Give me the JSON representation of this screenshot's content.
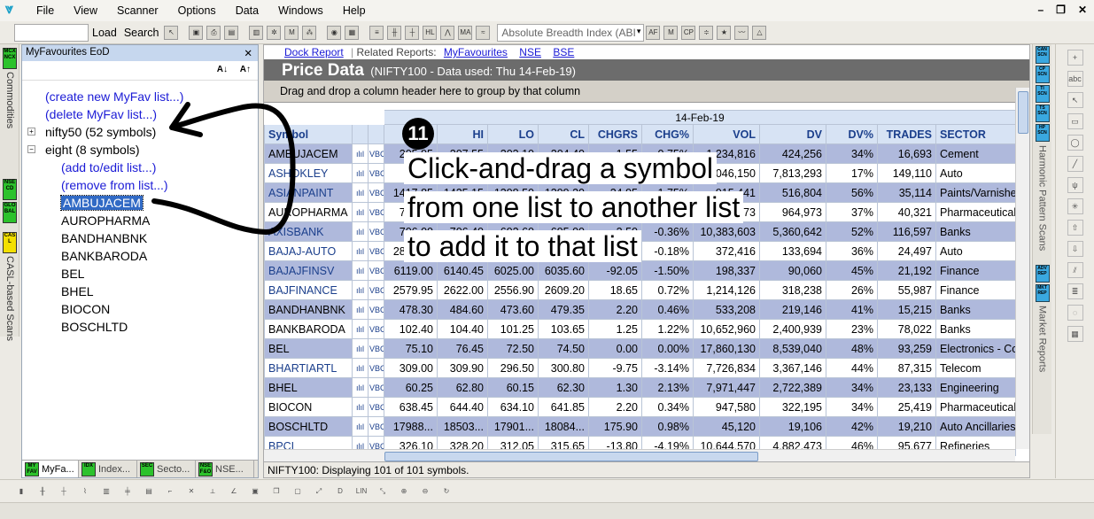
{
  "menu": [
    "File",
    "View",
    "Scanner",
    "Options",
    "Data",
    "Windows",
    "Help"
  ],
  "toolbar": {
    "load_label": "Load",
    "search_label": "Search",
    "breadth_select": "Absolute Breadth Index (ABI"
  },
  "left_tabs": [
    {
      "icon": "MCX NCX",
      "label": "Commodities"
    },
    {
      "icon": "NSE CD",
      "label": ""
    },
    {
      "icon": "GLO BAL",
      "label": ""
    },
    {
      "icon": "CAS L",
      "label": "CASL-based Scans"
    }
  ],
  "myfav": {
    "title": "MyFavourites EoD",
    "sort_az": "A↓",
    "sort_za": "A↑",
    "tree": [
      {
        "text": "(create new MyFav list...)",
        "type": "link",
        "indent": 0
      },
      {
        "text": "(delete MyFav list...)",
        "type": "link",
        "indent": 0
      },
      {
        "text": "nifty50 (52 symbols)",
        "type": "folder",
        "indent": 0,
        "exp": "+"
      },
      {
        "text": "eight (8 symbols)",
        "type": "folder",
        "indent": 0,
        "exp": "−"
      },
      {
        "text": "(add to/edit list...)",
        "type": "link",
        "indent": 1
      },
      {
        "text": "(remove from list...)",
        "type": "link",
        "indent": 1
      },
      {
        "text": "AMBUJACEM",
        "type": "item",
        "indent": 1,
        "selected": true
      },
      {
        "text": "AUROPHARMA",
        "type": "item",
        "indent": 1
      },
      {
        "text": "BANDHANBNK",
        "type": "item",
        "indent": 1
      },
      {
        "text": "BANKBARODA",
        "type": "item",
        "indent": 1
      },
      {
        "text": "BEL",
        "type": "item",
        "indent": 1
      },
      {
        "text": "BHEL",
        "type": "item",
        "indent": 1
      },
      {
        "text": "BIOCON",
        "type": "item",
        "indent": 1
      },
      {
        "text": "BOSCHLTD",
        "type": "item",
        "indent": 1
      }
    ],
    "bottom_tabs": [
      {
        "icon": "MY FAV",
        "label": "MyFa..."
      },
      {
        "icon": "IDX",
        "label": "Index..."
      },
      {
        "icon": "SEC",
        "label": "Secto..."
      },
      {
        "icon": "NSE F&O",
        "label": "NSE..."
      }
    ]
  },
  "related": {
    "dock": "Dock Report",
    "prefix": "Related Reports:",
    "links": [
      "MyFavourites",
      "NSE",
      "BSE"
    ]
  },
  "price_data": {
    "title": "Price Data",
    "subtitle": "(NIFTY100 - Data used: Thu 14-Feb-19)",
    "group_hint": "Drag and drop a column header here to group by that column",
    "date_header": "14-Feb-19",
    "columns": [
      "Symbol",
      "",
      "",
      "OP",
      "HI",
      "LO",
      "CL",
      "CHGRS",
      "CHG%",
      "VOL",
      "DV",
      "DV%",
      "TRADES",
      "SECTOR"
    ],
    "rows": [
      {
        "sym": "AMBUJACEM",
        "op": "205.95",
        "hi": "207.55",
        "lo": "203.10",
        "cl": "204.40",
        "chgrs": "-1.55",
        "chgp": "-0.75%",
        "vol": "1,234,816",
        "dv": "424,256",
        "dvp": "34%",
        "trades": "16,693",
        "sector": "Cement",
        "hi_row": true,
        "blue": false
      },
      {
        "sym": "ASHOKLEY",
        "op": "86.40",
        "hi": "87.15",
        "lo": "85.60",
        "cl": "86.45",
        "chgrs": "0.05",
        "chgp": "0.06%",
        "vol": "9,046,150",
        "dv": "7,813,293",
        "dvp": "17%",
        "trades": "149,110",
        "sector": "Auto",
        "hi_row": false,
        "blue": true
      },
      {
        "sym": "ASIANPAINT",
        "op": "1417.85",
        "hi": "1425.15",
        "lo": "1398.50",
        "cl": "1399.20",
        "chgrs": "-24.95",
        "chgp": "-1.75%",
        "vol": "915,441",
        "dv": "516,804",
        "dvp": "56%",
        "trades": "35,114",
        "sector": "Paints/Varnishes",
        "hi_row": true,
        "blue": true
      },
      {
        "sym": "AUROPHARMA",
        "op": "759.00",
        "hi": "771.80",
        "lo": "752.20",
        "cl": "758.65",
        "chgrs": "0.55",
        "chgp": "0.07%",
        "vol": "2,594,973",
        "dv": "964,973",
        "dvp": "37%",
        "trades": "40,321",
        "sector": "Pharmaceuticals",
        "hi_row": false,
        "blue": false
      },
      {
        "sym": "AXISBANK",
        "op": "706.00",
        "hi": "706.40",
        "lo": "692.60",
        "cl": "695.00",
        "chgrs": "-2.50",
        "chgp": "-0.36%",
        "vol": "10,383,603",
        "dv": "5,360,642",
        "dvp": "52%",
        "trades": "116,597",
        "sector": "Banks",
        "hi_row": true,
        "blue": true
      },
      {
        "sym": "BAJAJ-AUTO",
        "op": "2850.00",
        "hi": "2870.00",
        "lo": "2830.00",
        "cl": "2845.00",
        "chgrs": "-5.00",
        "chgp": "-0.18%",
        "vol": "372,416",
        "dv": "133,694",
        "dvp": "36%",
        "trades": "24,497",
        "sector": "Auto",
        "hi_row": false,
        "blue": true
      },
      {
        "sym": "BAJAJFINSV",
        "op": "6119.00",
        "hi": "6140.45",
        "lo": "6025.00",
        "cl": "6035.60",
        "chgrs": "-92.05",
        "chgp": "-1.50%",
        "vol": "198,337",
        "dv": "90,060",
        "dvp": "45%",
        "trades": "21,192",
        "sector": "Finance",
        "hi_row": true,
        "blue": true
      },
      {
        "sym": "BAJFINANCE",
        "op": "2579.95",
        "hi": "2622.00",
        "lo": "2556.90",
        "cl": "2609.20",
        "chgrs": "18.65",
        "chgp": "0.72%",
        "vol": "1,214,126",
        "dv": "318,238",
        "dvp": "26%",
        "trades": "55,987",
        "sector": "Finance",
        "hi_row": false,
        "blue": true
      },
      {
        "sym": "BANDHANBNK",
        "op": "478.30",
        "hi": "484.60",
        "lo": "473.60",
        "cl": "479.35",
        "chgrs": "2.20",
        "chgp": "0.46%",
        "vol": "533,208",
        "dv": "219,146",
        "dvp": "41%",
        "trades": "15,215",
        "sector": "Banks",
        "hi_row": true,
        "blue": false
      },
      {
        "sym": "BANKBARODA",
        "op": "102.40",
        "hi": "104.40",
        "lo": "101.25",
        "cl": "103.65",
        "chgrs": "1.25",
        "chgp": "1.22%",
        "vol": "10,652,960",
        "dv": "2,400,939",
        "dvp": "23%",
        "trades": "78,022",
        "sector": "Banks",
        "hi_row": false,
        "blue": false
      },
      {
        "sym": "BEL",
        "op": "75.10",
        "hi": "76.45",
        "lo": "72.50",
        "cl": "74.50",
        "chgrs": "0.00",
        "chgp": "0.00%",
        "vol": "17,860,130",
        "dv": "8,539,040",
        "dvp": "48%",
        "trades": "93,259",
        "sector": "Electronics - Co",
        "hi_row": true,
        "blue": false
      },
      {
        "sym": "BHARTIARTL",
        "op": "309.00",
        "hi": "309.90",
        "lo": "296.50",
        "cl": "300.80",
        "chgrs": "-9.75",
        "chgp": "-3.14%",
        "vol": "7,726,834",
        "dv": "3,367,146",
        "dvp": "44%",
        "trades": "87,315",
        "sector": "Telecom",
        "hi_row": false,
        "blue": true
      },
      {
        "sym": "BHEL",
        "op": "60.25",
        "hi": "62.80",
        "lo": "60.15",
        "cl": "62.30",
        "chgrs": "1.30",
        "chgp": "2.13%",
        "vol": "7,971,447",
        "dv": "2,722,389",
        "dvp": "34%",
        "trades": "23,133",
        "sector": "Engineering",
        "hi_row": true,
        "blue": false
      },
      {
        "sym": "BIOCON",
        "op": "638.45",
        "hi": "644.40",
        "lo": "634.10",
        "cl": "641.85",
        "chgrs": "2.20",
        "chgp": "0.34%",
        "vol": "947,580",
        "dv": "322,195",
        "dvp": "34%",
        "trades": "25,419",
        "sector": "Pharmaceuticals",
        "hi_row": false,
        "blue": false
      },
      {
        "sym": "BOSCHLTD",
        "op": "17988...",
        "hi": "18503...",
        "lo": "17901...",
        "cl": "18084...",
        "chgrs": "175.90",
        "chgp": "0.98%",
        "vol": "45,120",
        "dv": "19,106",
        "dvp": "42%",
        "trades": "19,210",
        "sector": "Auto Ancillaries",
        "hi_row": true,
        "blue": false
      },
      {
        "sym": "BPCL",
        "op": "326.10",
        "hi": "328.20",
        "lo": "312.05",
        "cl": "315.65",
        "chgrs": "-13.80",
        "chgp": "-4.19%",
        "vol": "10,644,570",
        "dv": "4,882,473",
        "dvp": "46%",
        "trades": "95,677",
        "sector": "Refineries",
        "hi_row": false,
        "blue": true
      }
    ],
    "status": "NIFTY100: Displaying 101 of 101 symbols."
  },
  "right_tabs": {
    "harmonic": {
      "icons": [
        "CAN SCN",
        "CP SCN",
        "TI SCN",
        "TS SCN",
        "HP SCN"
      ],
      "label": "Harmonic Pattern Scans"
    },
    "market": {
      "icons": [
        "ADV REP",
        "MKT REP"
      ],
      "label": "Market Reports"
    }
  },
  "annotation": {
    "badge": "11",
    "lines": [
      "Click-and-drag a symbol",
      "from one list to another list",
      "to add it to that list"
    ]
  }
}
